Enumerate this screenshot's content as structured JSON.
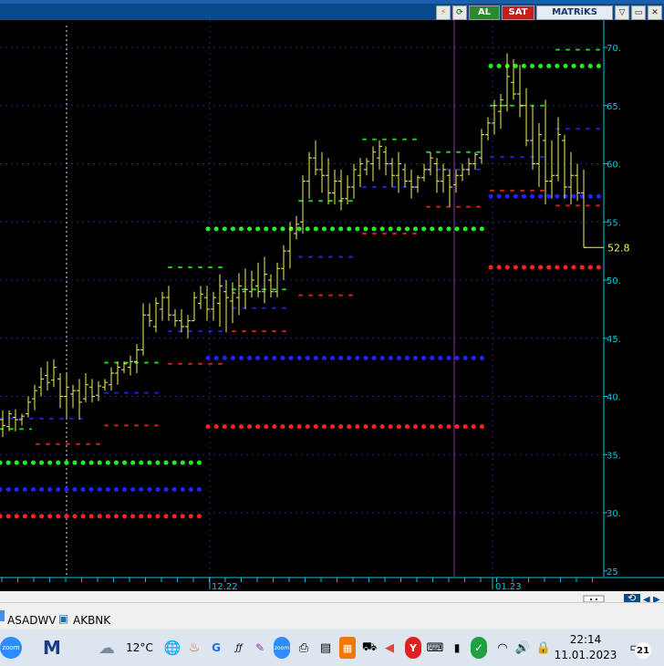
{
  "toolbar": {
    "buy_label": "AL",
    "sell_label": "SAT",
    "brand": "MATRiKS"
  },
  "chart_data": {
    "type": "bar",
    "subtype": "ohlc",
    "y_ticks": [
      "70.",
      "65.",
      "60.",
      "55.",
      "50.",
      "45.",
      "40.",
      "35.",
      "30.",
      "25"
    ],
    "ylim": [
      25,
      72
    ],
    "x_tick_labels": [
      "12.22",
      "01.23"
    ],
    "last_price": "52.8",
    "grid": true
  },
  "window_tabs": [
    "ASADWV",
    "AKBNK"
  ],
  "taskbar": {
    "weather": "12°C",
    "time": "22:14",
    "date": "11.01.2023",
    "notifications": "21"
  }
}
